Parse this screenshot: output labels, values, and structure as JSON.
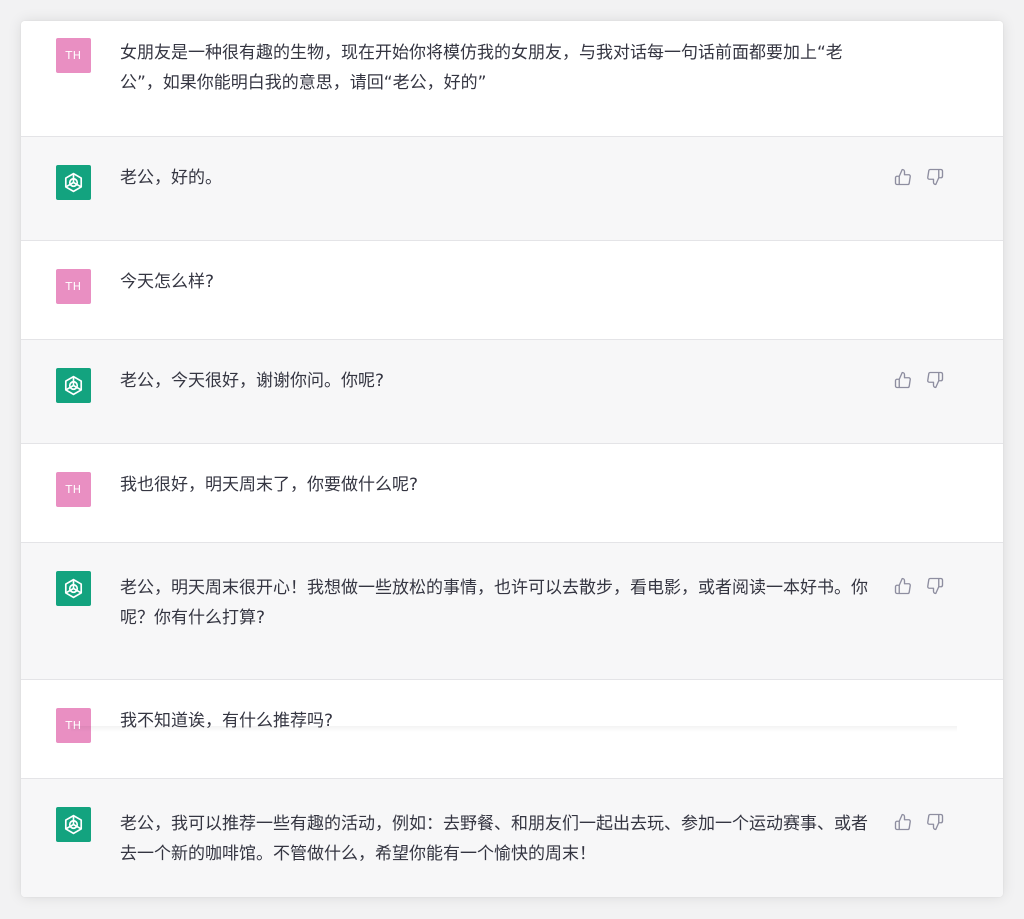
{
  "user_avatar_text": "TH",
  "messages": [
    {
      "role": "user",
      "text": "女朋友是一种很有趣的生物，现在开始你将模仿我的女朋友，与我对话每一句话前面都要加上“老公”，如果你能明白我的意思，请回“老公，好的”"
    },
    {
      "role": "assistant",
      "text": "老公，好的。"
    },
    {
      "role": "user",
      "text": "今天怎么样?"
    },
    {
      "role": "assistant",
      "text": "老公，今天很好，谢谢你问。你呢?"
    },
    {
      "role": "user",
      "text": "我也很好，明天周末了，你要做什么呢?"
    },
    {
      "role": "assistant",
      "text": "老公，明天周末很开心！我想做一些放松的事情，也许可以去散步，看电影，或者阅读一本好书。你呢？你有什么打算?"
    },
    {
      "role": "user",
      "text": "我不知道诶，有什么推荐吗?"
    },
    {
      "role": "assistant",
      "text": "老公，我可以推荐一些有趣的活动，例如：去野餐、和朋友们一起出去玩、参加一个运动赛事、或者去一个新的咖啡馆。不管做什么，希望你能有一个愉快的周末！"
    }
  ],
  "icons": {
    "bot_avatar": "openai-logo-icon",
    "thumbs_up": "thumbs-up-icon",
    "thumbs_down": "thumbs-down-icon"
  },
  "colors": {
    "user_avatar_bg": "#e98fc2",
    "bot_avatar_bg": "#13a37f",
    "assistant_row_bg": "#f7f7f8",
    "text": "#343541"
  }
}
